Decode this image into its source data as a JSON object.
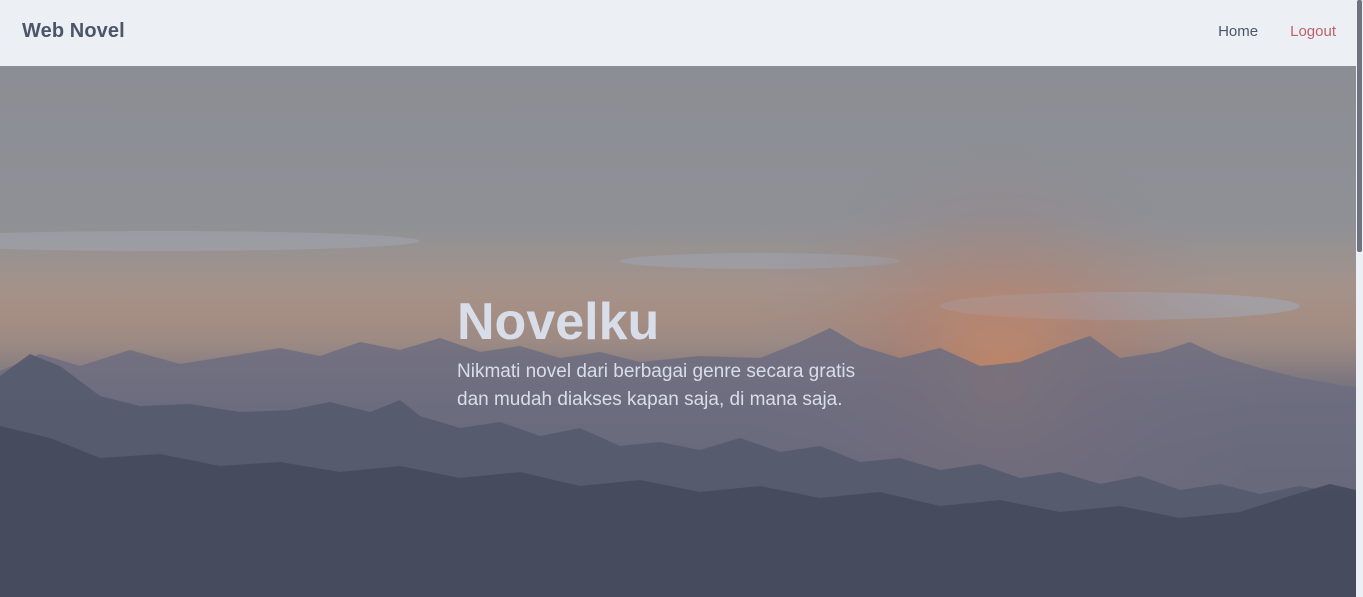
{
  "navbar": {
    "brand": "Web Novel",
    "links": [
      {
        "label": "Home"
      },
      {
        "label": "Logout"
      }
    ]
  },
  "hero": {
    "title": "Novelku",
    "subtitle_line1": "Nikmati novel dari berbagai genre secara gratis",
    "subtitle_line2": "dan mudah diakses kapan saja, di mana saja."
  },
  "colors": {
    "navbar_bg": "#eceff4",
    "brand_text": "#4c566a",
    "logout_text": "#bf616a",
    "hero_text": "#d8dee9"
  }
}
